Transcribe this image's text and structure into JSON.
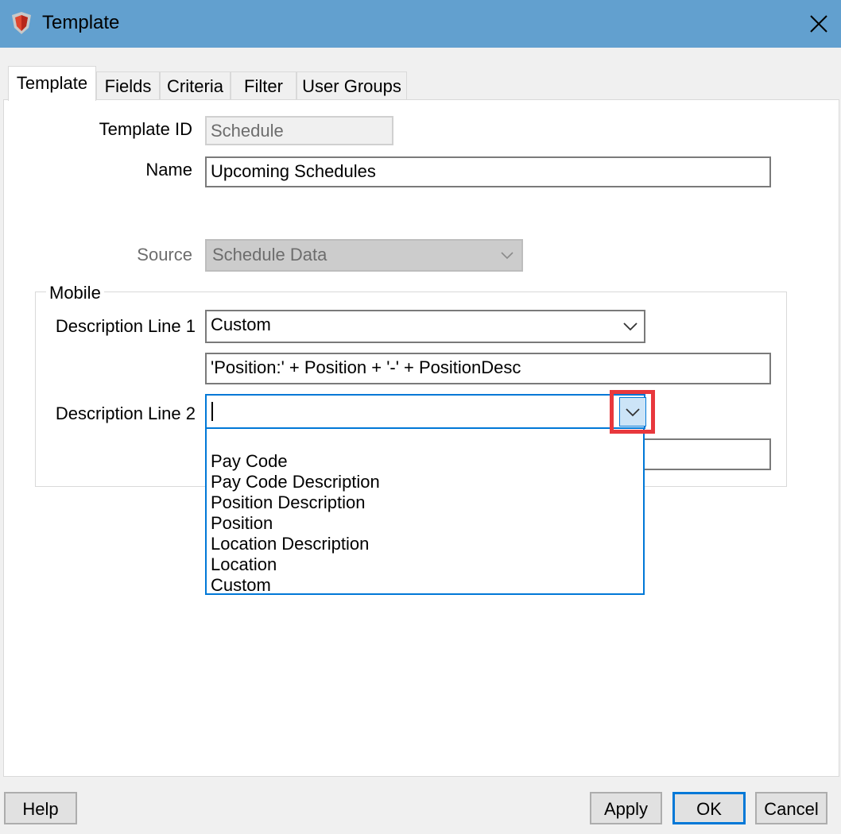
{
  "window": {
    "title": "Template"
  },
  "tabs": [
    {
      "label": "Template"
    },
    {
      "label": "Fields"
    },
    {
      "label": "Criteria"
    },
    {
      "label": "Filter"
    },
    {
      "label": "User Groups"
    }
  ],
  "form": {
    "template_id_label": "Template ID",
    "template_id_value": "Schedule",
    "name_label": "Name",
    "name_value": "Upcoming Schedules",
    "source_label": "Source",
    "source_value": "Schedule Data"
  },
  "mobile": {
    "group_label": "Mobile",
    "desc1_label": "Description Line 1",
    "desc1_value": "Custom",
    "desc1_expression": "'Position:' + Position + '-' + PositionDesc",
    "desc2_label": "Description Line 2",
    "desc2_value": "",
    "desc2_options": [
      "Pay Code",
      "Pay Code Description",
      "Position Description",
      "Position",
      "Location Description",
      "Location",
      "Custom"
    ]
  },
  "buttons": {
    "help": "Help",
    "apply": "Apply",
    "ok": "OK",
    "cancel": "Cancel"
  },
  "colors": {
    "titlebar": "#62a0cf",
    "focus": "#0078d7",
    "highlight": "#e8383d"
  }
}
